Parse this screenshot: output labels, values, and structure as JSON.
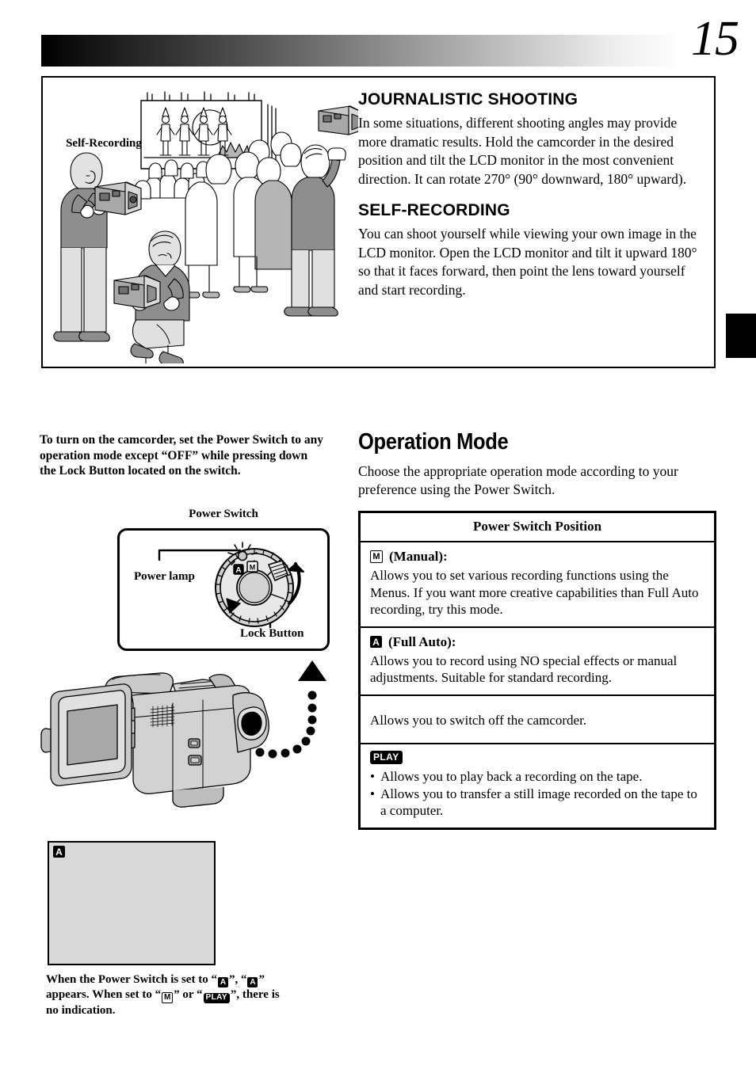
{
  "page": {
    "number": "15"
  },
  "top_panel": {
    "figure_label": "Self-Recording",
    "sections": [
      {
        "heading": "JOURNALISTIC SHOOTING",
        "body": "In some situations, different shooting angles may provide more dramatic results. Hold the camcorder in the desired position and tilt the LCD monitor in the most convenient direction. It can rotate 270° (90° downward, 180° upward)."
      },
      {
        "heading": "SELF-RECORDING",
        "body": "You can shoot yourself while viewing your own image in the LCD monitor. Open the LCD monitor and tilt it upward 180° so that it faces forward, then point the lens toward yourself and start recording."
      }
    ]
  },
  "left_column": {
    "intro": "To turn on the camcorder, set the Power Switch to any operation mode except “OFF” while pressing down the Lock Button located on the switch.",
    "diagram_caption": "Power Switch",
    "dial_labels": {
      "power_lamp": "Power lamp",
      "lock_button": "Lock Button",
      "dial_mode_a": "A",
      "dial_mode_m": "M"
    },
    "lcd_indicator": "A",
    "bottom_note_parts": {
      "p1": "When the Power Switch is set to “",
      "b1": "A",
      "p2": "”, “",
      "b2": "A",
      "p3": "” appears. When set to “",
      "b3": "M",
      "p4": "” or “",
      "b4": "PLAY",
      "p5": "”, there is no indication."
    }
  },
  "right_column": {
    "heading": "Operation Mode",
    "subtitle": "Choose the appropriate operation mode according to your preference using the Power Switch.",
    "table": {
      "header": "Power Switch Position",
      "rows": [
        {
          "badge": "M",
          "badge_style": "outline",
          "title": "(Manual):",
          "desc": "Allows you to set various recording functions using the Menus. If you want more creative capabilities than Full Auto recording, try this mode.",
          "bullets": []
        },
        {
          "badge": "A",
          "badge_style": "solid",
          "title": "(Full Auto):",
          "desc": "Allows you to record using NO special effects or manual adjustments. Suitable for standard recording.",
          "bullets": []
        },
        {
          "badge": "",
          "badge_style": "none",
          "title": "",
          "desc": "Allows you to switch off the camcorder.",
          "bullets": []
        },
        {
          "badge": "PLAY",
          "badge_style": "play",
          "title": "",
          "desc": "",
          "bullets": [
            "Allows you to play back a recording on the tape.",
            "Allows you to transfer a still image recorded on the tape to a computer."
          ]
        }
      ]
    }
  },
  "colors": {
    "ink": "#000000",
    "lcd_fill": "#d9d9d9",
    "gradient_start": "#000000",
    "gradient_end": "#ffffff"
  }
}
